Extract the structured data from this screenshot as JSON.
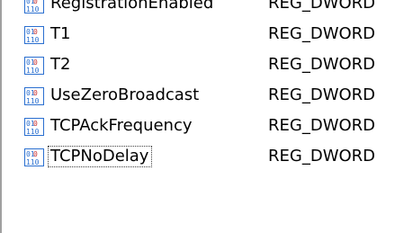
{
  "registry_values": [
    {
      "name": "RegistrationEnabled",
      "type": "REG_DWORD",
      "icon": "reg-dword-icon"
    },
    {
      "name": "T1",
      "type": "REG_DWORD",
      "icon": "reg-dword-icon"
    },
    {
      "name": "T2",
      "type": "REG_DWORD",
      "icon": "reg-dword-icon"
    },
    {
      "name": "UseZeroBroadcast",
      "type": "REG_DWORD",
      "icon": "reg-dword-icon"
    },
    {
      "name": "TCPAckFrequency",
      "type": "REG_DWORD",
      "icon": "reg-dword-icon"
    },
    {
      "name": "TCPNoDelay",
      "type": "REG_DWORD",
      "icon": "reg-dword-icon",
      "focused": true
    }
  ],
  "colors": {
    "icon_blue": "#2a6fd0",
    "icon_red": "#c83232",
    "focus_outline": "#404040"
  }
}
